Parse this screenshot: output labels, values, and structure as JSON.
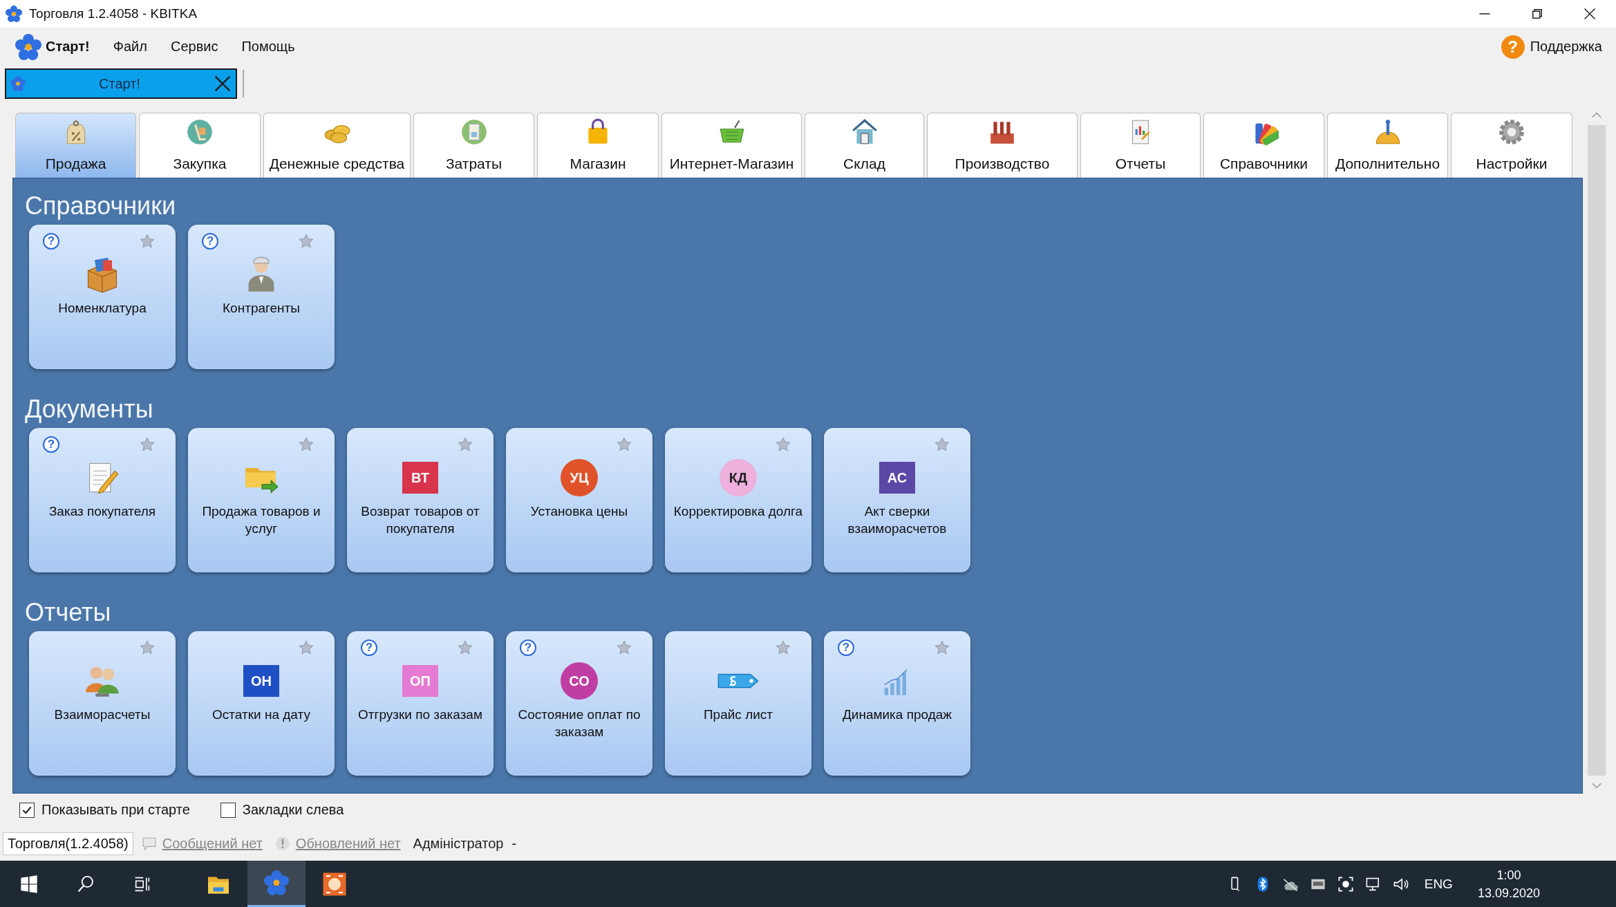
{
  "window": {
    "title": "Торговля 1.2.4058 - KBITKA"
  },
  "menu": [
    {
      "label": "Старт!",
      "kind": "start"
    },
    {
      "label": "Файл",
      "kind": "item"
    },
    {
      "label": "Сервис",
      "kind": "item"
    },
    {
      "label": "Помощь",
      "kind": "item"
    }
  ],
  "support": {
    "mark": "?",
    "label": "Поддержка"
  },
  "doc_tabs": [
    {
      "label": "Старт!",
      "selected": true
    }
  ],
  "module_tabs": [
    {
      "label": "Продажа",
      "selected": true
    },
    {
      "label": "Закупка",
      "selected": false
    },
    {
      "label": "Денежные средства",
      "selected": false
    },
    {
      "label": "Затраты",
      "selected": false
    },
    {
      "label": "Магазин",
      "selected": false
    },
    {
      "label": "Интернет-Магазин",
      "selected": false
    },
    {
      "label": "Склад",
      "selected": false
    },
    {
      "label": "Производство",
      "selected": false
    },
    {
      "label": "Отчеты",
      "selected": false
    },
    {
      "label": "Справочники",
      "selected": false
    },
    {
      "label": "Дополнительно",
      "selected": false
    },
    {
      "label": "Настройки",
      "selected": false
    }
  ],
  "sections": [
    {
      "title": "Справочники",
      "tiles": [
        {
          "label": "Номенклатура",
          "kind": "icon",
          "help": "?"
        },
        {
          "label": "Контрагенты",
          "kind": "icon",
          "help": "?"
        }
      ]
    },
    {
      "title": "Документы",
      "tiles": [
        {
          "label": "Заказ покупателя",
          "kind": "icon",
          "help": "?"
        },
        {
          "label": "Продажа товаров и услуг",
          "kind": "icon"
        },
        {
          "label": "Возврат товаров от покупателя",
          "kind": "badge",
          "badge": {
            "text": "ВТ",
            "kind": "square",
            "color": "#d8344c"
          }
        },
        {
          "label": "Установка цены",
          "kind": "badge",
          "badge": {
            "text": "УЦ",
            "kind": "circle",
            "color": "#e0522a"
          }
        },
        {
          "label": "Корректировка долга",
          "kind": "badge",
          "badge": {
            "text": "КД",
            "kind": "circle",
            "color": "#eeb0dc"
          }
        },
        {
          "label": "Акт сверки взаиморасчетов",
          "kind": "badge",
          "badge": {
            "text": "АС",
            "kind": "square",
            "color": "#5c46a6"
          }
        }
      ]
    },
    {
      "title": "Отчеты",
      "tiles": [
        {
          "label": "Взаиморасчеты",
          "kind": "icon"
        },
        {
          "label": "Остатки на дату",
          "kind": "badge",
          "badge": {
            "text": "ОН",
            "kind": "square",
            "color": "#1f4fc4"
          }
        },
        {
          "label": "Отгрузки по заказам",
          "kind": "badge",
          "help": "?",
          "badge": {
            "text": "ОП",
            "kind": "square",
            "color": "#e47ad2"
          }
        },
        {
          "label": "Состояние оплат по заказам",
          "kind": "badge",
          "help": "?",
          "badge": {
            "text": "СО",
            "kind": "circle",
            "color": "#c03ea4"
          }
        },
        {
          "label": "Прайс лист",
          "kind": "icon"
        },
        {
          "label": "Динамика продаж",
          "kind": "icon",
          "help": "?"
        }
      ]
    }
  ],
  "options": [
    {
      "label": "Показывать при старте",
      "checked": true
    },
    {
      "label": "Закладки слева",
      "checked": false
    }
  ],
  "status_bar": [
    {
      "label": "Торговля(1.2.4058)",
      "kind": "version"
    },
    {
      "label": "Сообщений нет",
      "kind": "messages"
    },
    {
      "label": "Обновлений нет",
      "kind": "updates"
    },
    {
      "label": "Адміністратор",
      "kind": "user"
    },
    {
      "label": "-",
      "kind": "text"
    }
  ],
  "taskbar": {
    "apps": [
      {
        "selected": false
      },
      {
        "selected": true
      },
      {
        "selected": false
      }
    ],
    "language": "ENG",
    "time": "1:00",
    "date": "13.09.2020"
  }
}
